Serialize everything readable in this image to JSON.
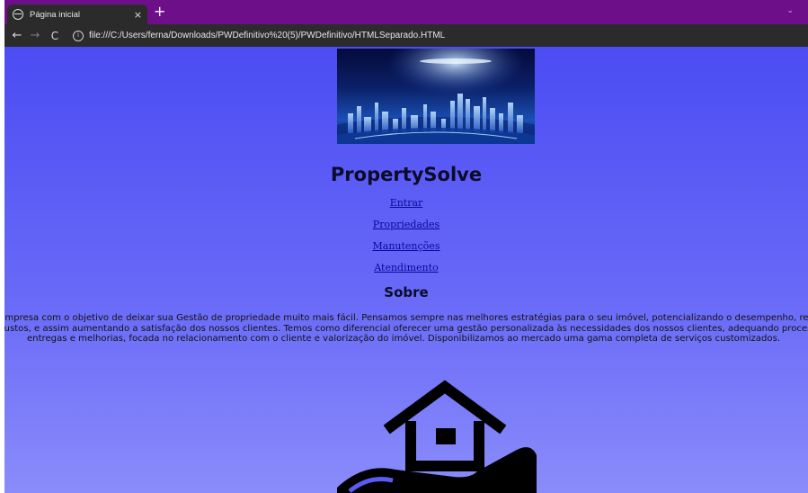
{
  "browser": {
    "tab_title": "Página inicial",
    "tab_close": "×",
    "new_tab": "+",
    "tab_dropdown": "⌄",
    "back": "←",
    "forward": "→",
    "reload": "C",
    "info": "i",
    "url": "file:///C:/Users/ferna/Downloads/PWDefinitivo%20(5)/PWDefinitivo/HTMLSeparado.HTML"
  },
  "page": {
    "brand": "PropertySolve",
    "nav": [
      {
        "label": "Entrar"
      },
      {
        "label": "Propriedades"
      },
      {
        "label": "Manutenções"
      },
      {
        "label": "Atendimento"
      }
    ],
    "about_title": "Sobre",
    "about_lines": [
      "Empresa com o objetivo de deixar sua Gestão de propriedade muito mais fácil. Pensamos sempre nas melhores estratégias para o seu imóvel, potencializando o desempenho, red",
      "custos, e assim aumentando a satisfação dos nossos clientes. Temos como diferencial oferecer uma gestão personalizada às necessidades dos nossos clientes, adequando processo",
      "entregas e melhorias, focada no relacionamento com o cliente e valorização do imóvel. Disponibilizamos ao mercado uma gama completa de serviços customizados."
    ],
    "icons": {
      "banner": "city-skyline-banner-image",
      "house": "house-in-hand-icon"
    }
  },
  "colors": {
    "tabbar": "#6e0f8a",
    "toolbar": "#2b2b2b",
    "page_top": "#4b4cf3",
    "page_bottom": "#8a8cfb",
    "link": "#0a0a9a"
  }
}
